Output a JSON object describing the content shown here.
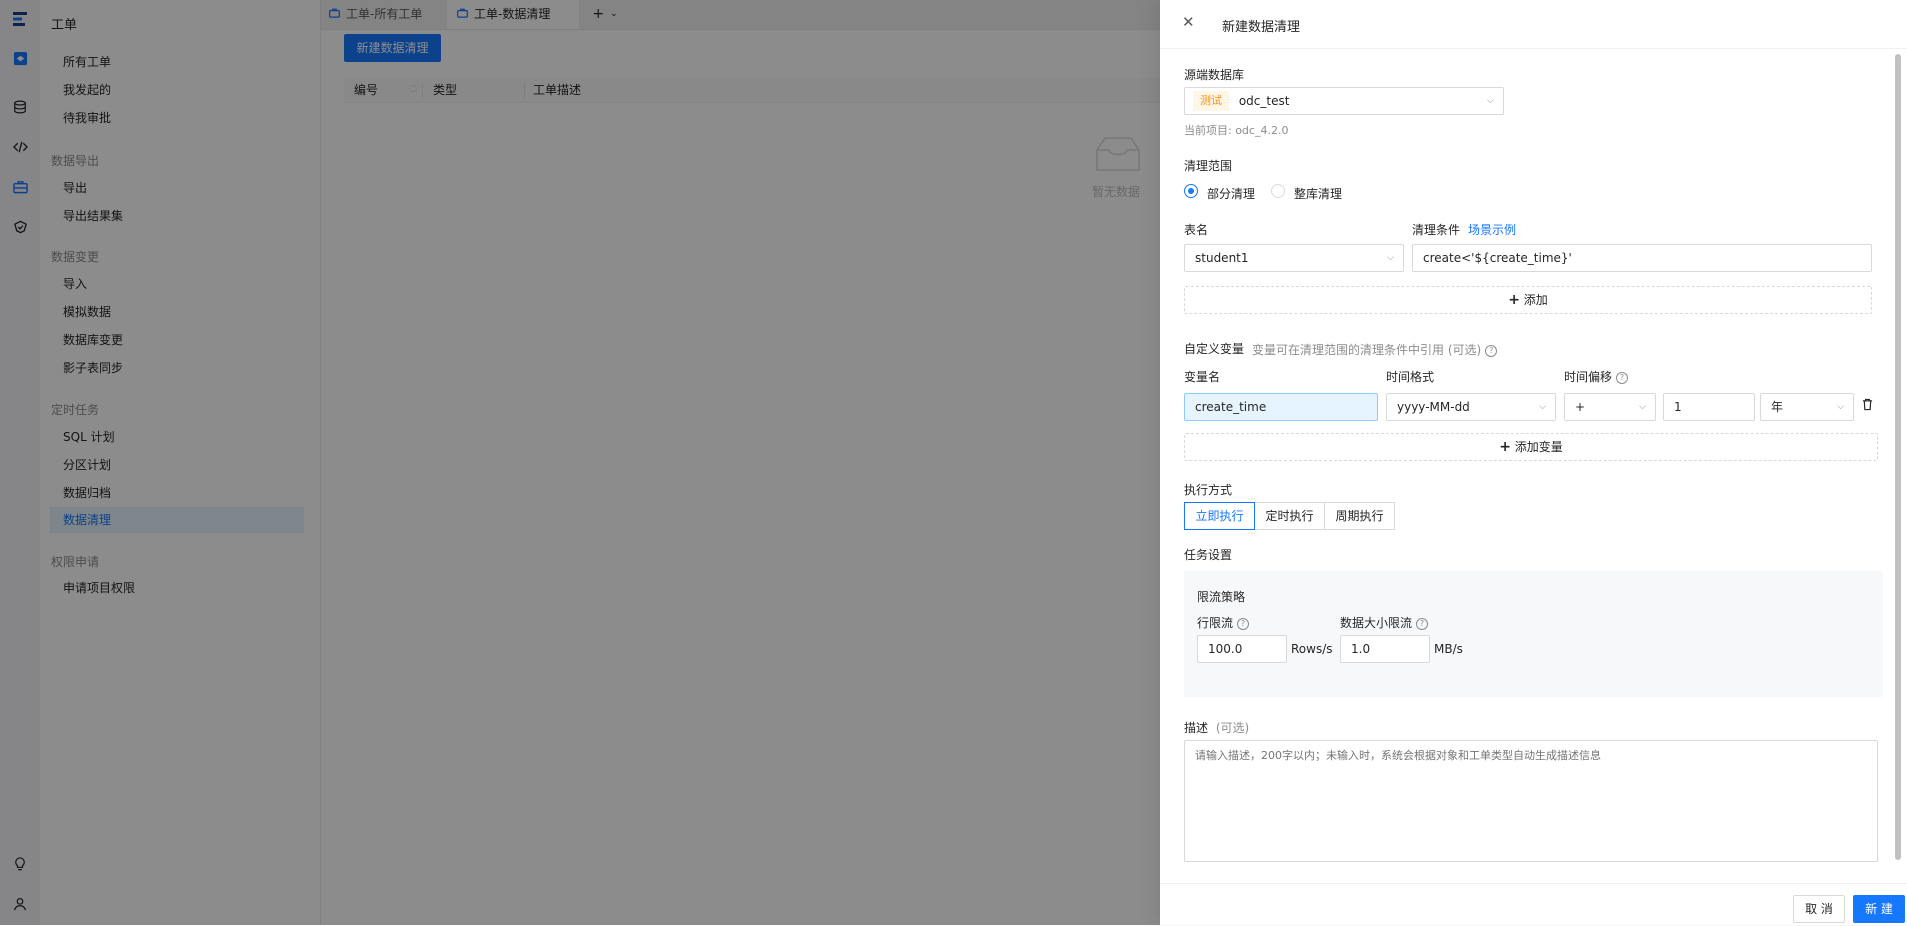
{
  "nav": {
    "title": "工单",
    "items_top": [
      "所有工单",
      "我发起的",
      "待我审批"
    ],
    "groups": [
      {
        "name": "数据导出",
        "items": [
          "导出",
          "导出结果集"
        ]
      },
      {
        "name": "数据变更",
        "items": [
          "导入",
          "模拟数据",
          "数据库变更",
          "影子表同步"
        ]
      },
      {
        "name": "定时任务",
        "items": [
          "SQL 计划",
          "分区计划",
          "数据归档",
          "数据清理"
        ]
      },
      {
        "name": "权限申请",
        "items": [
          "申请项目权限"
        ]
      }
    ],
    "active_item": "数据清理"
  },
  "tabs": {
    "items": [
      "工单-所有工单",
      "工单-数据清理"
    ],
    "add_icon": "plus-icon"
  },
  "main": {
    "new_button": "新建数据清理",
    "columns": [
      "编号",
      "类型",
      "工单描述"
    ],
    "empty_text": "暂无数据"
  },
  "drawer": {
    "title": "新建数据清理",
    "source_db_label": "源端数据库",
    "env_tag": "测试",
    "source_db_value": "odc_test",
    "current_project": "当前项目: odc_4.2.0",
    "scope_label": "清理范围",
    "scope_options": [
      "部分清理",
      "整库清理"
    ],
    "scope_selected": "部分清理",
    "table_name_label": "表名",
    "condition_label": "清理条件",
    "example_link": "场景示例",
    "table_value": "student1",
    "condition_value": "create<'${create_time}'",
    "add_label": "添加",
    "custom_var_label": "自定义变量",
    "custom_var_hint": "变量可在清理范围的清理条件中引用 (可选)",
    "var_name_label": "变量名",
    "time_format_label": "时间格式",
    "time_offset_label": "时间偏移",
    "var_name_value": "create_time",
    "time_format_value": "yyyy-MM-dd",
    "offset_sign": "+",
    "offset_value": "1",
    "offset_unit": "年",
    "add_var_label": "添加变量",
    "exec_label": "执行方式",
    "exec_options": [
      "立即执行",
      "定时执行",
      "周期执行"
    ],
    "exec_selected": "立即执行",
    "task_settings_label": "任务设置",
    "throttle_label": "限流策略",
    "row_limit_label": "行限流",
    "row_limit_value": "100.0",
    "row_limit_unit": "Rows/s",
    "size_limit_label": "数据大小限流",
    "size_limit_value": "1.0",
    "size_limit_unit": "MB/s",
    "desc_label": "描述",
    "desc_optional": "(可选)",
    "desc_placeholder": "请输入描述，200字以内；未输入时，系统会根据对象和工单类型自动生成描述信息",
    "cancel_label": "取 消",
    "submit_label": "新 建"
  },
  "colors": {
    "primary": "#1677ff",
    "env_tag_bg": "#fff7e6",
    "env_tag_fg": "#fa8c16"
  }
}
